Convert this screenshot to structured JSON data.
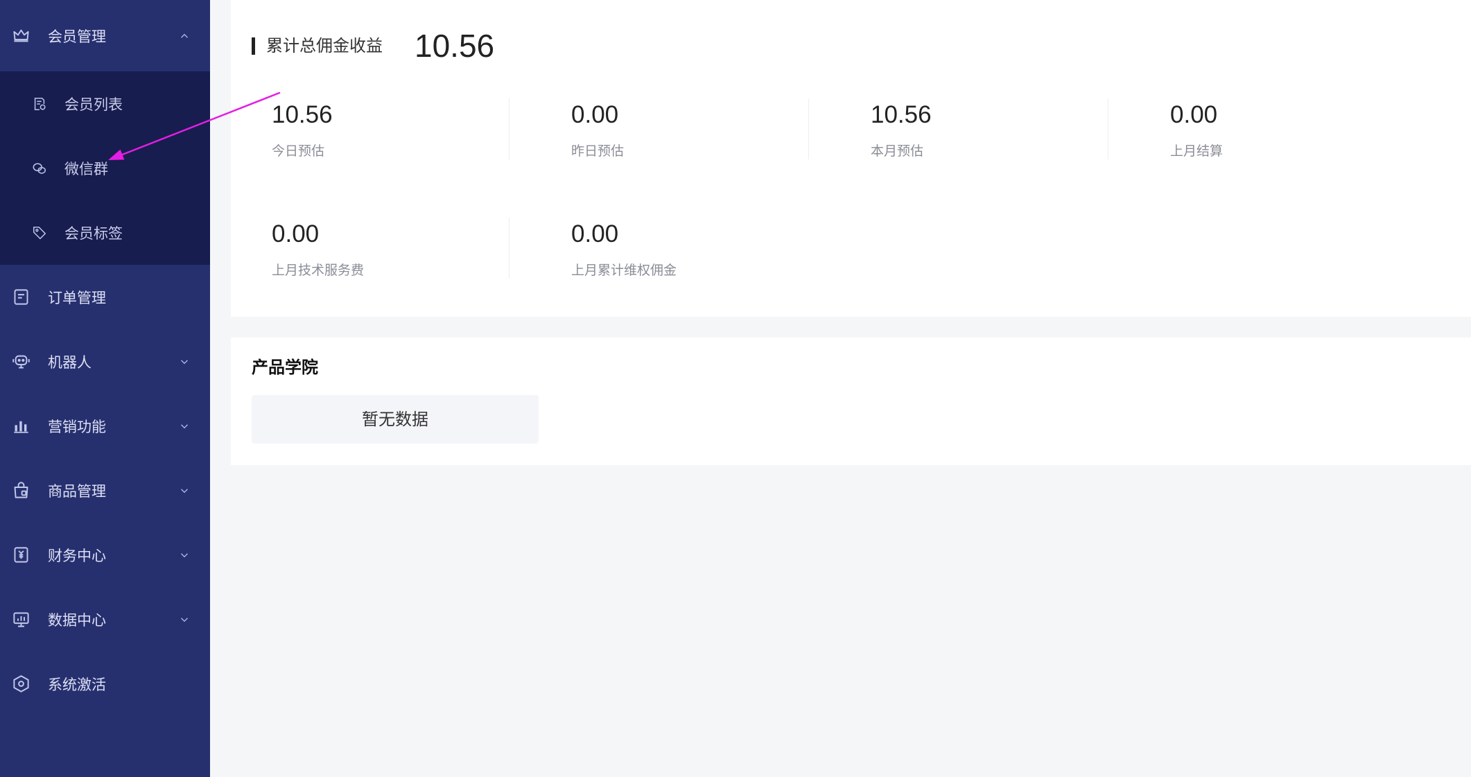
{
  "sidebar": {
    "member_group": {
      "label": "会员管理",
      "icon": "crown-icon",
      "expanded": true,
      "children": [
        {
          "label": "会员列表",
          "icon": "member-list-icon"
        },
        {
          "label": "微信群",
          "icon": "wechat-group-icon"
        },
        {
          "label": "会员标签",
          "icon": "member-tag-icon"
        }
      ]
    },
    "items": [
      {
        "label": "订单管理",
        "icon": "order-icon",
        "has_children": false
      },
      {
        "label": "机器人",
        "icon": "robot-icon",
        "has_children": true
      },
      {
        "label": "营销功能",
        "icon": "marketing-chart-icon",
        "has_children": true
      },
      {
        "label": "商品管理",
        "icon": "goods-bag-icon",
        "has_children": true
      },
      {
        "label": "财务中心",
        "icon": "finance-icon",
        "has_children": true
      },
      {
        "label": "数据中心",
        "icon": "data-monitor-icon",
        "has_children": true
      },
      {
        "label": "系统激活",
        "icon": "system-hexagon-icon",
        "has_children": false
      }
    ]
  },
  "earnings": {
    "title": "累计总佣金收益",
    "total": "10.56",
    "stats": [
      {
        "value": "10.56",
        "label": "今日预估"
      },
      {
        "value": "0.00",
        "label": "昨日预估"
      },
      {
        "value": "10.56",
        "label": "本月预估"
      },
      {
        "value": "0.00",
        "label": "上月结算"
      },
      {
        "value": "0.00",
        "label": "上月技术服务费"
      },
      {
        "value": "0.00",
        "label": "上月累计维权佣金"
      }
    ]
  },
  "academy": {
    "title": "产品学院",
    "empty_text": "暂无数据"
  },
  "colors": {
    "sidebar_bg": "#27306f",
    "submenu_bg": "#171d4f",
    "page_bg": "#f5f6f8",
    "annotation_arrow": "#e31ee3"
  }
}
